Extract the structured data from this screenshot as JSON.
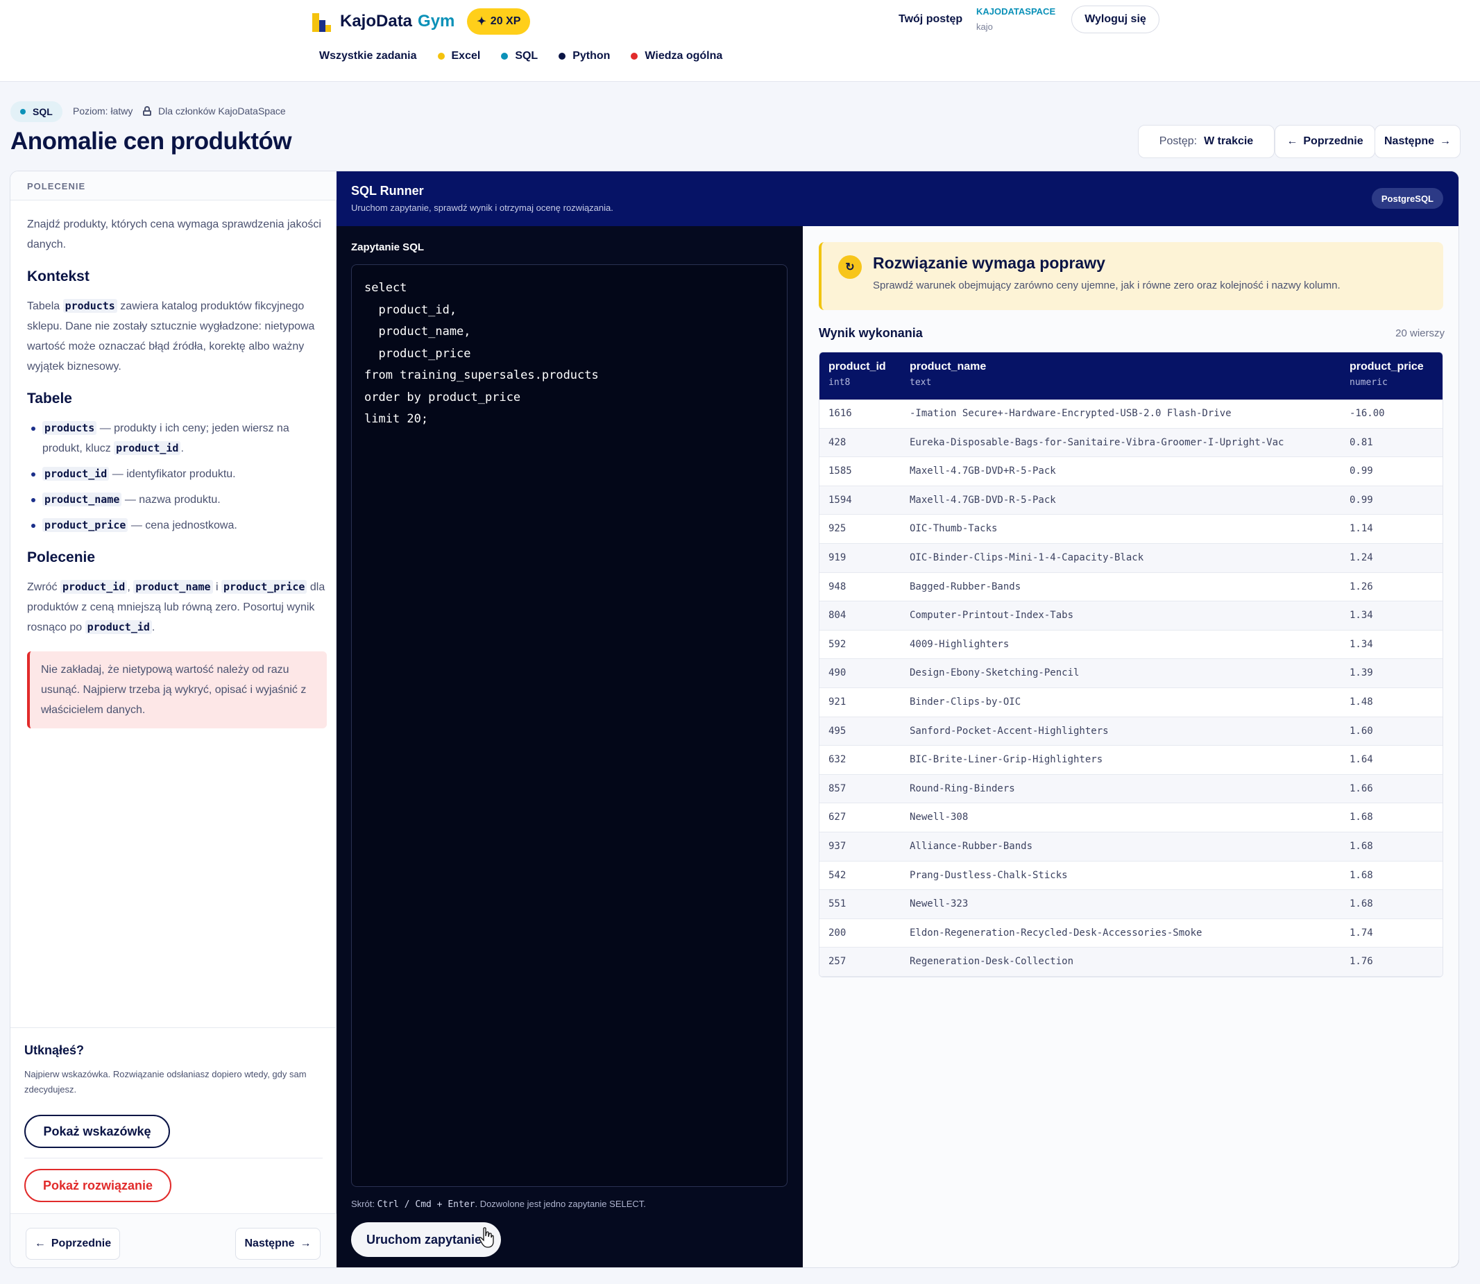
{
  "header": {
    "brand": "KajoData",
    "brand_accent": "Gym",
    "xp": "20 XP",
    "progress_link": "Twój postęp",
    "workspace": "KAJODATASPACE",
    "username": "kajo",
    "logout": "Wyloguj się",
    "nav": [
      {
        "label": "Wszystkie zadania",
        "color": ""
      },
      {
        "label": "Excel",
        "color": "#f4c20d"
      },
      {
        "label": "SQL",
        "color": "#0b91b8"
      },
      {
        "label": "Python",
        "color": "#0a1445"
      },
      {
        "label": "Wiedza ogólna",
        "color": "#e12b2b"
      }
    ]
  },
  "task": {
    "tag": "SQL",
    "level": "Poziom: łatwy",
    "members": "Dla członków KajoDataSpace",
    "title": "Anomalie cen produktów",
    "status_label": "Postęp:",
    "status_value": "W trakcie",
    "prev": "Poprzednie",
    "next": "Następne"
  },
  "brief": {
    "heading": "POLECENIE",
    "intro": "Znajdź produkty, których cena wymaga sprawdzenia jakości danych.",
    "context_title": "Kontekst",
    "context_pre": "Tabela ",
    "context_code": "products",
    "context_post": " zawiera katalog produktów fikcyjnego sklepu. Dane nie zostały sztucznie wygładzone: nietypowa wartość może oznaczać błąd źródła, korektę albo ważny wyjątek biznesowy.",
    "tables_title": "Tabele",
    "tables": [
      {
        "code": "products",
        "text": " — produkty i ich ceny; jeden wiersz na produkt, klucz ",
        "code2": "product_id",
        "text2": "."
      },
      {
        "code": "product_id",
        "text": " — identyfikator produktu.",
        "code2": "",
        "text2": ""
      },
      {
        "code": "product_name",
        "text": " — nazwa produktu.",
        "code2": "",
        "text2": ""
      },
      {
        "code": "product_price",
        "text": " — cena jednostkowa.",
        "code2": "",
        "text2": ""
      }
    ],
    "task_title": "Polecenie",
    "task_p1": "Zwróć ",
    "task_c1": "product_id",
    "task_p2": ", ",
    "task_c2": "product_name",
    "task_p3": " i ",
    "task_c3": "product_price",
    "task_p4": " dla produktów z ceną mniejszą lub równą zero. Posortuj wynik rosnąco po ",
    "task_c4": "product_id",
    "task_p5": ".",
    "warning": "Nie zakładaj, że nietypową wartość należy od razu usunąć. Najpierw trzeba ją wykryć, opisać i wyjaśnić z właścicielem danych.",
    "stuck_title": "Utknąłeś?",
    "stuck_note": "Najpierw wskazówka. Rozwiązanie odsłaniasz dopiero wtedy, gdy sam zdecydujesz.",
    "hint_btn": "Pokaż wskazówkę",
    "solution_btn": "Pokaż rozwiązanie",
    "prev": "Poprzednie",
    "next": "Następne"
  },
  "runner": {
    "title": "SQL Runner",
    "subtitle": "Uruchom zapytanie, sprawdź wynik i otrzymaj ocenę rozwiązania.",
    "engine": "PostgreSQL",
    "query_label": "Zapytanie SQL",
    "query": "select\n  product_id,\n  product_name,\n  product_price\nfrom training_supersales.products\norder by product_price\nlimit 20;",
    "shortcut_pre": "Skrót: ",
    "shortcut_keys": "Ctrl / Cmd + Enter",
    "shortcut_post": ". Dozwolone jest jedno zapytanie SELECT.",
    "run_btn": "Uruchom zapytanie"
  },
  "result": {
    "alert_icon": "refresh-icon",
    "alert_title": "Rozwiązanie wymaga poprawy",
    "alert_desc": "Sprawdź warunek obejmujący zarówno ceny ujemne, jak i równe zero oraz kolejność i nazwy kolumn.",
    "title": "Wynik wykonania",
    "count": "20 wierszy",
    "columns": [
      {
        "name": "product_id",
        "type": "int8"
      },
      {
        "name": "product_name",
        "type": "text"
      },
      {
        "name": "product_price",
        "type": "numeric"
      }
    ],
    "rows": [
      [
        "1616",
        "-Imation Secure+-Hardware-Encrypted-USB-2.0 Flash-Drive",
        "-16.00"
      ],
      [
        "428",
        "Eureka-Disposable-Bags-for-Sanitaire-Vibra-Groomer-I-Upright-Vac",
        "0.81"
      ],
      [
        "1585",
        "Maxell-4.7GB-DVD+R-5-Pack",
        "0.99"
      ],
      [
        "1594",
        "Maxell-4.7GB-DVD-R-5-Pack",
        "0.99"
      ],
      [
        "925",
        "OIC-Thumb-Tacks",
        "1.14"
      ],
      [
        "919",
        "OIC-Binder-Clips-Mini-1-4-Capacity-Black",
        "1.24"
      ],
      [
        "948",
        "Bagged-Rubber-Bands",
        "1.26"
      ],
      [
        "804",
        "Computer-Printout-Index-Tabs",
        "1.34"
      ],
      [
        "592",
        "4009-Highlighters",
        "1.34"
      ],
      [
        "490",
        "Design-Ebony-Sketching-Pencil",
        "1.39"
      ],
      [
        "921",
        "Binder-Clips-by-OIC",
        "1.48"
      ],
      [
        "495",
        "Sanford-Pocket-Accent-Highlighters",
        "1.60"
      ],
      [
        "632",
        "BIC-Brite-Liner-Grip-Highlighters",
        "1.64"
      ],
      [
        "857",
        "Round-Ring-Binders",
        "1.66"
      ],
      [
        "627",
        "Newell-308",
        "1.68"
      ],
      [
        "937",
        "Alliance-Rubber-Bands",
        "1.68"
      ],
      [
        "542",
        "Prang-Dustless-Chalk-Sticks",
        "1.68"
      ],
      [
        "551",
        "Newell-323",
        "1.68"
      ],
      [
        "200",
        "Eldon-Regeneration-Recycled-Desk-Accessories-Smoke",
        "1.74"
      ],
      [
        "257",
        "Regeneration-Desk-Collection",
        "1.76"
      ]
    ]
  }
}
